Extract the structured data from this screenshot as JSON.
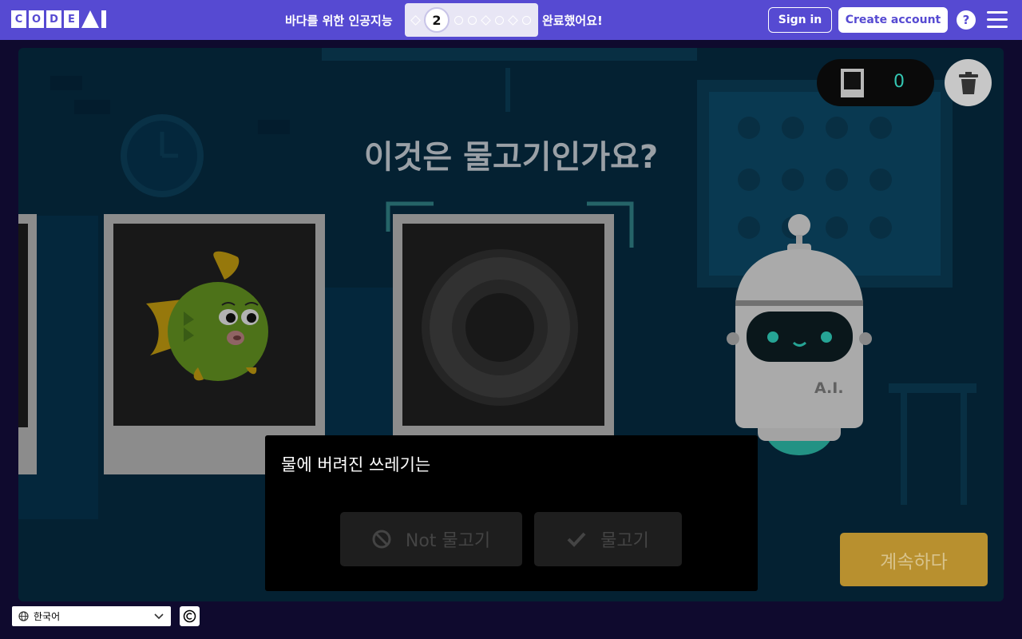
{
  "header": {
    "logo_letters": [
      "C",
      "O",
      "D",
      "E"
    ],
    "lesson_title": "바다를 위한 인공지능",
    "progress_current": "2",
    "completed_text": "완료했어요!",
    "sign_in_label": "Sign in",
    "create_account_label": "Create account",
    "help_label": "?"
  },
  "game": {
    "counter_value": "0",
    "question": "이것은 물고기인가요?",
    "caption": "물에 버려진 쓰레기는",
    "not_fish_label": "Not 물고기",
    "fish_label": "물고기",
    "continue_label": "계속하다",
    "robot_label": "A.I."
  },
  "footer": {
    "language": "한국어"
  },
  "colors": {
    "brand": "#564ad2",
    "stage": "#05293e",
    "accent_teal": "#34c6b2",
    "continue": "#b8902f"
  }
}
